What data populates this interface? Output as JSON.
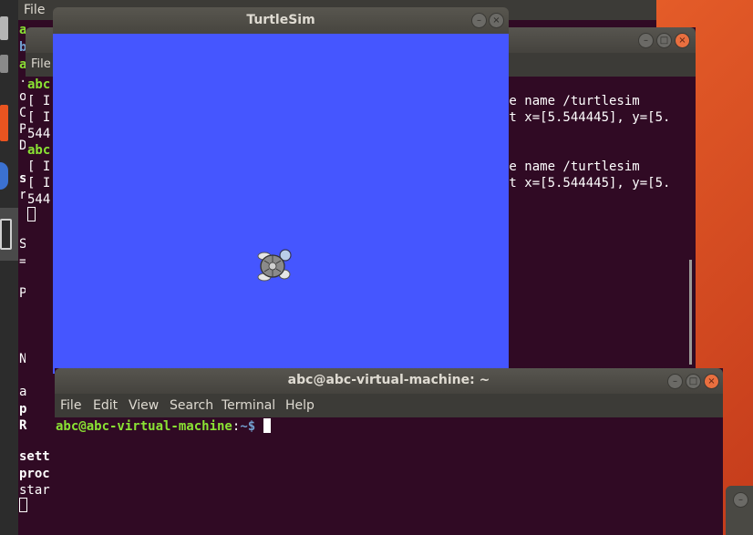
{
  "launcher": {
    "colors": {
      "bar": "#2c2c2c",
      "accent": "#e95420"
    }
  },
  "bg_terminal_left": {
    "menu_file": "File",
    "lines": [
      {
        "text": "a",
        "color": "green"
      },
      {
        "text": "b",
        "color": "blue"
      },
      {
        "text": "a",
        "color": "green"
      },
      {
        "text": "File",
        "color": "white"
      },
      {
        "text": "abc",
        "color": "green"
      },
      {
        "text": "[ I",
        "color": "white"
      },
      {
        "text": "[ I",
        "color": "white"
      },
      {
        "text": "544",
        "color": "white"
      },
      {
        "text": "abc",
        "color": "green"
      },
      {
        "text": "[ I",
        "color": "white"
      },
      {
        "text": "[ I",
        "color": "white"
      },
      {
        "text": "544",
        "color": "white"
      }
    ],
    "side_chars": [
      "·",
      "o",
      "C",
      "P",
      "D",
      "s",
      "r",
      "S",
      "=",
      "P",
      "N",
      "a",
      "p",
      "R"
    ],
    "bottom_lines": [
      "sett",
      "proc",
      "star"
    ]
  },
  "bg_terminal_right": {
    "line1": "le name /turtlesim",
    "line2": "at x=[5.544445], y=[5.",
    "line3": "le name /turtlesim",
    "line4": "at x=[5.544445], y=[5."
  },
  "turtlesim": {
    "title": "TurtleSim",
    "background_color": "#4556ff",
    "turtle_icon": "turtle-icon"
  },
  "front_terminal": {
    "title": "abc@abc-virtual-machine: ~",
    "menu": [
      "File",
      "Edit",
      "View",
      "Search",
      "Terminal",
      "Help"
    ],
    "prompt_user": "abc@abc-virtual-machine",
    "prompt_sep": ":",
    "prompt_path": "~$ "
  }
}
